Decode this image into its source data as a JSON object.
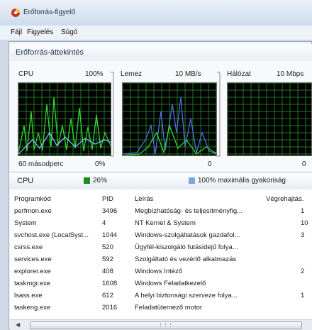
{
  "window": {
    "title": "Erőforrás-figyelő",
    "icon": "resource-monitor-icon"
  },
  "menu": [
    "Fájl",
    "Figyelés",
    "Súgó"
  ],
  "overview": {
    "title": "Erőforrás-áttekintés"
  },
  "graphs": {
    "cpu": {
      "label": "CPU",
      "max": "100%",
      "min": "0%",
      "footer": "60 másodperc"
    },
    "disk": {
      "label": "Lemez",
      "max": "10 MB/s",
      "min": "0"
    },
    "network": {
      "label": "Hálózat",
      "max": "10 Mbps",
      "min": "0"
    }
  },
  "cpu_section": {
    "title": "CPU",
    "usage": "26%",
    "usage_color": "#1f8a1f",
    "freq": "100% maximális gyakoriság",
    "freq_color": "#7ea6d8"
  },
  "table": {
    "headers": [
      "Programkód",
      "PID",
      "Leírás",
      "Végrehajtás."
    ],
    "rows": [
      [
        "perfmon.exe",
        "3496",
        "Megbízhatóság- és teljesítményfig..."
      ],
      [
        "System",
        "4",
        "NT Kernel & System"
      ],
      [
        "svchost.exe (LocalSyst...",
        "1044",
        "Windows-szolgáltatások gazdafol..."
      ],
      [
        "csrss.exe",
        "520",
        "Ügyfél-kiszolgáló futásidejű folya..."
      ],
      [
        "services.exe",
        "592",
        "Szolgáltató és vezérlő alkalmazás"
      ],
      [
        "explorer.exe",
        "408",
        "Windows Intéző"
      ],
      [
        "taskmgr.exe",
        "1608",
        "Windows Feladatkezelő"
      ],
      [
        "lsass.exe",
        "612",
        "A helyi biztonsági szerveze folya..."
      ],
      [
        "taskeng.exe",
        "2016",
        "Feladatütemező motor"
      ]
    ],
    "exec_col": [
      "1",
      "10",
      "3",
      "",
      "",
      "2",
      "",
      "1",
      ""
    ]
  },
  "colors": {
    "graph_bg": "#000000",
    "grid": "#1f7a1f",
    "cpu_line": "#33d633",
    "disk_line": "#4f6fe8"
  }
}
